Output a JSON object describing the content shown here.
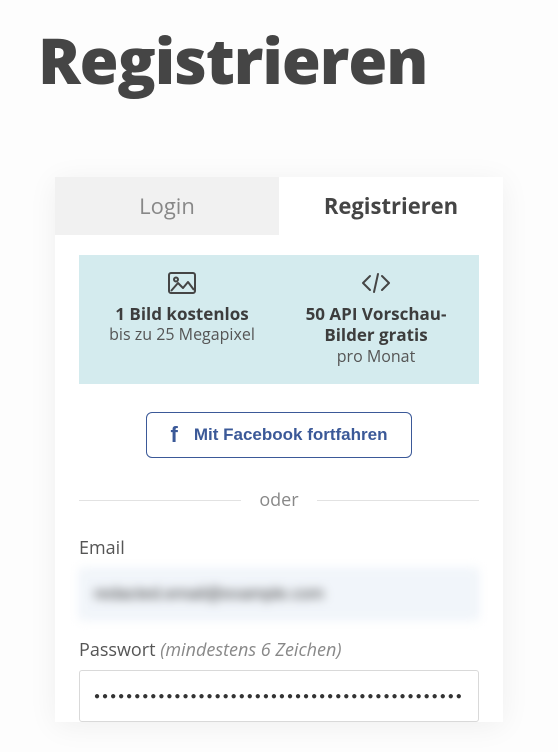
{
  "page": {
    "title": "Registrieren"
  },
  "tabs": {
    "login": "Login",
    "register": "Registrieren"
  },
  "promo": {
    "left": {
      "title": "1 Bild kostenlos",
      "sub": "bis zu 25 Megapixel"
    },
    "right": {
      "title": "50 API Vorschau-Bilder gratis",
      "sub": "pro Monat"
    }
  },
  "facebook": {
    "label": "Mit Facebook fortfahren"
  },
  "divider": {
    "label": "oder"
  },
  "email": {
    "label": "Email",
    "value": "redacted.email@example.com"
  },
  "password": {
    "label": "Passwort",
    "hint": "(mindestens 6 Zeichen)",
    "value": "●●●●●●●●●●●●●●●●●●●●●●●●●●●●●●●●●●●●●●●●●●●●●●●●"
  }
}
